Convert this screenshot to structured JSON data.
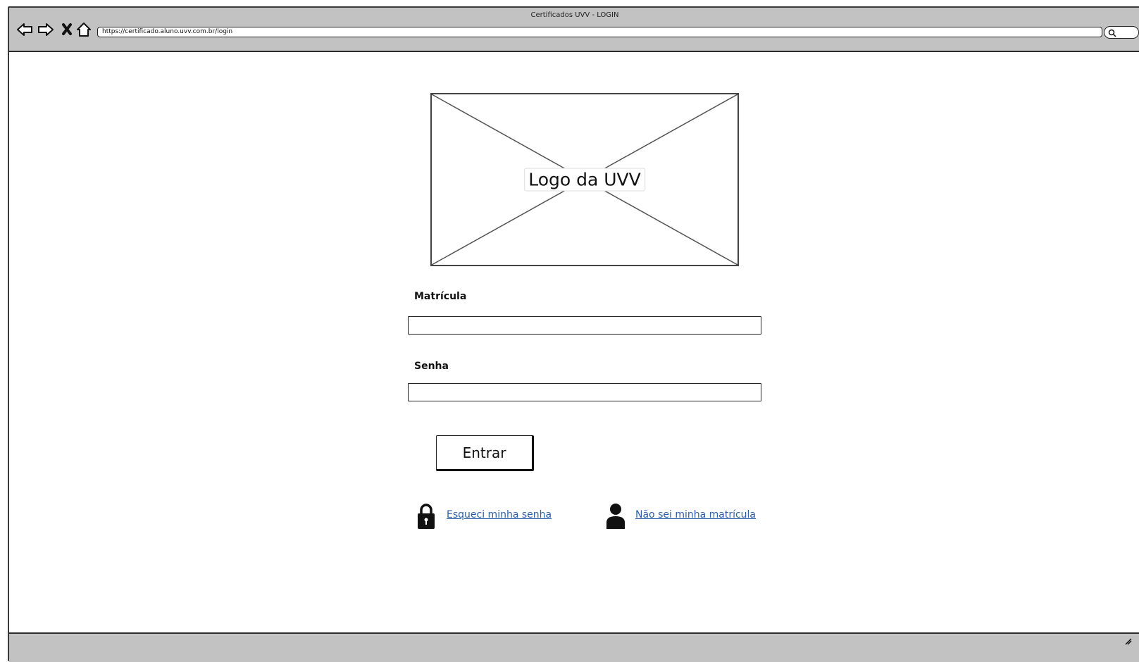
{
  "browser": {
    "window_title": "Certificados UVV - LOGIN",
    "url": "https://certificado.aluno.uvv.com.br/login",
    "nav_icons": [
      "back-arrow-icon",
      "forward-arrow-icon",
      "stop-icon",
      "home-icon"
    ],
    "search_icon": "search-icon"
  },
  "logo": {
    "label": "Logo da UVV"
  },
  "form": {
    "matricula_label": "Matrícula",
    "matricula_value": "",
    "senha_label": "Senha",
    "senha_value": "",
    "submit_label": "Entrar"
  },
  "links": {
    "forgot_password": {
      "icon": "lock-icon",
      "label": "Esqueci minha senha"
    },
    "forgot_registration": {
      "icon": "user-icon",
      "label": "Não sei minha matrícula"
    }
  },
  "colors": {
    "chrome": "#c2c2c2",
    "link": "#2a5fa8"
  }
}
